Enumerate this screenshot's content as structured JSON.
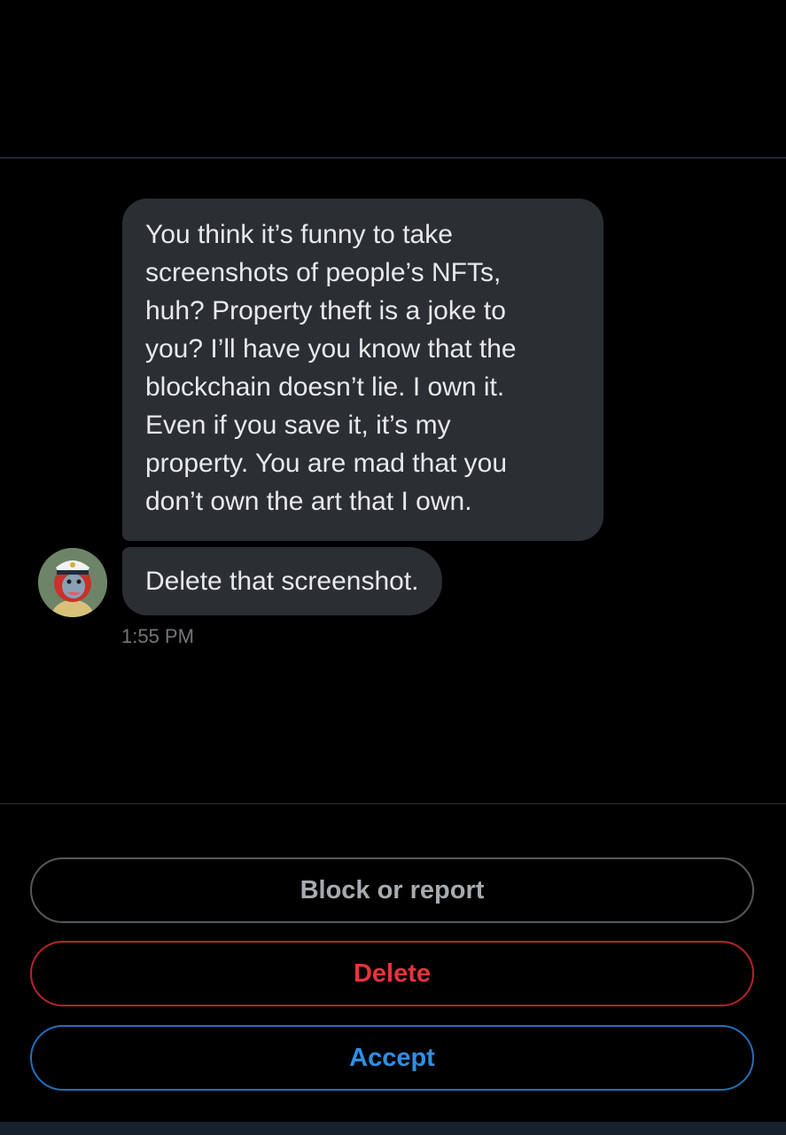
{
  "conversation": {
    "messages": [
      {
        "lines": [
          "You think it’s funny to take",
          "screenshots of people’s NFTs,",
          "huh? Property theft is a joke to",
          "you? I’ll have you know that the",
          "blockchain doesn’t lie. I own it.",
          "Even if you save it, it’s my",
          "property. You are mad that you",
          "don’t own the art that I own."
        ]
      },
      {
        "text": "Delete that screenshot."
      }
    ],
    "timestamp": "1:55 PM",
    "avatar_icon": "nft-lion-avatar"
  },
  "actions": {
    "block_label": "Block or report",
    "delete_label": "Delete",
    "accept_label": "Accept"
  },
  "colors": {
    "background": "#000000",
    "bubble": "#2b2f34",
    "delete": "#e8333c",
    "accept": "#2f8fe5"
  }
}
